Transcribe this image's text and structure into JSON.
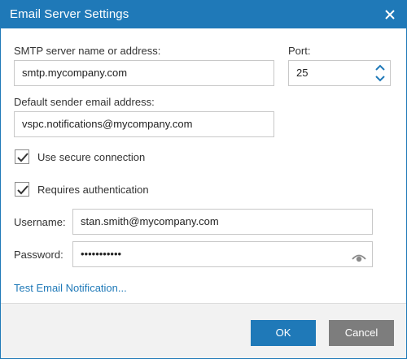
{
  "window": {
    "title": "Email Server Settings"
  },
  "smtp": {
    "label": "SMTP server name or address:",
    "value": "smtp.mycompany.com"
  },
  "port": {
    "label": "Port:",
    "value": "25"
  },
  "sender": {
    "label": "Default sender email address:",
    "value": "vspc.notifications@mycompany.com"
  },
  "secure": {
    "label": "Use secure connection",
    "checked": true
  },
  "auth": {
    "label": "Requires authentication",
    "checked": true
  },
  "username": {
    "label": "Username:",
    "value": "stan.smith@mycompany.com"
  },
  "password": {
    "label": "Password:",
    "value": "•••••••••••"
  },
  "test_link": "Test Email Notification...",
  "buttons": {
    "ok": "OK",
    "cancel": "Cancel"
  },
  "colors": {
    "accent": "#1f79b8",
    "cancel": "#7d7d7d",
    "footer": "#f2f2f2",
    "border": "#c8c8c8"
  },
  "icons": {
    "close": "close-icon",
    "spinner": "spinner-arrows-icon",
    "reveal": "eye-icon",
    "check": "checkmark-icon"
  }
}
